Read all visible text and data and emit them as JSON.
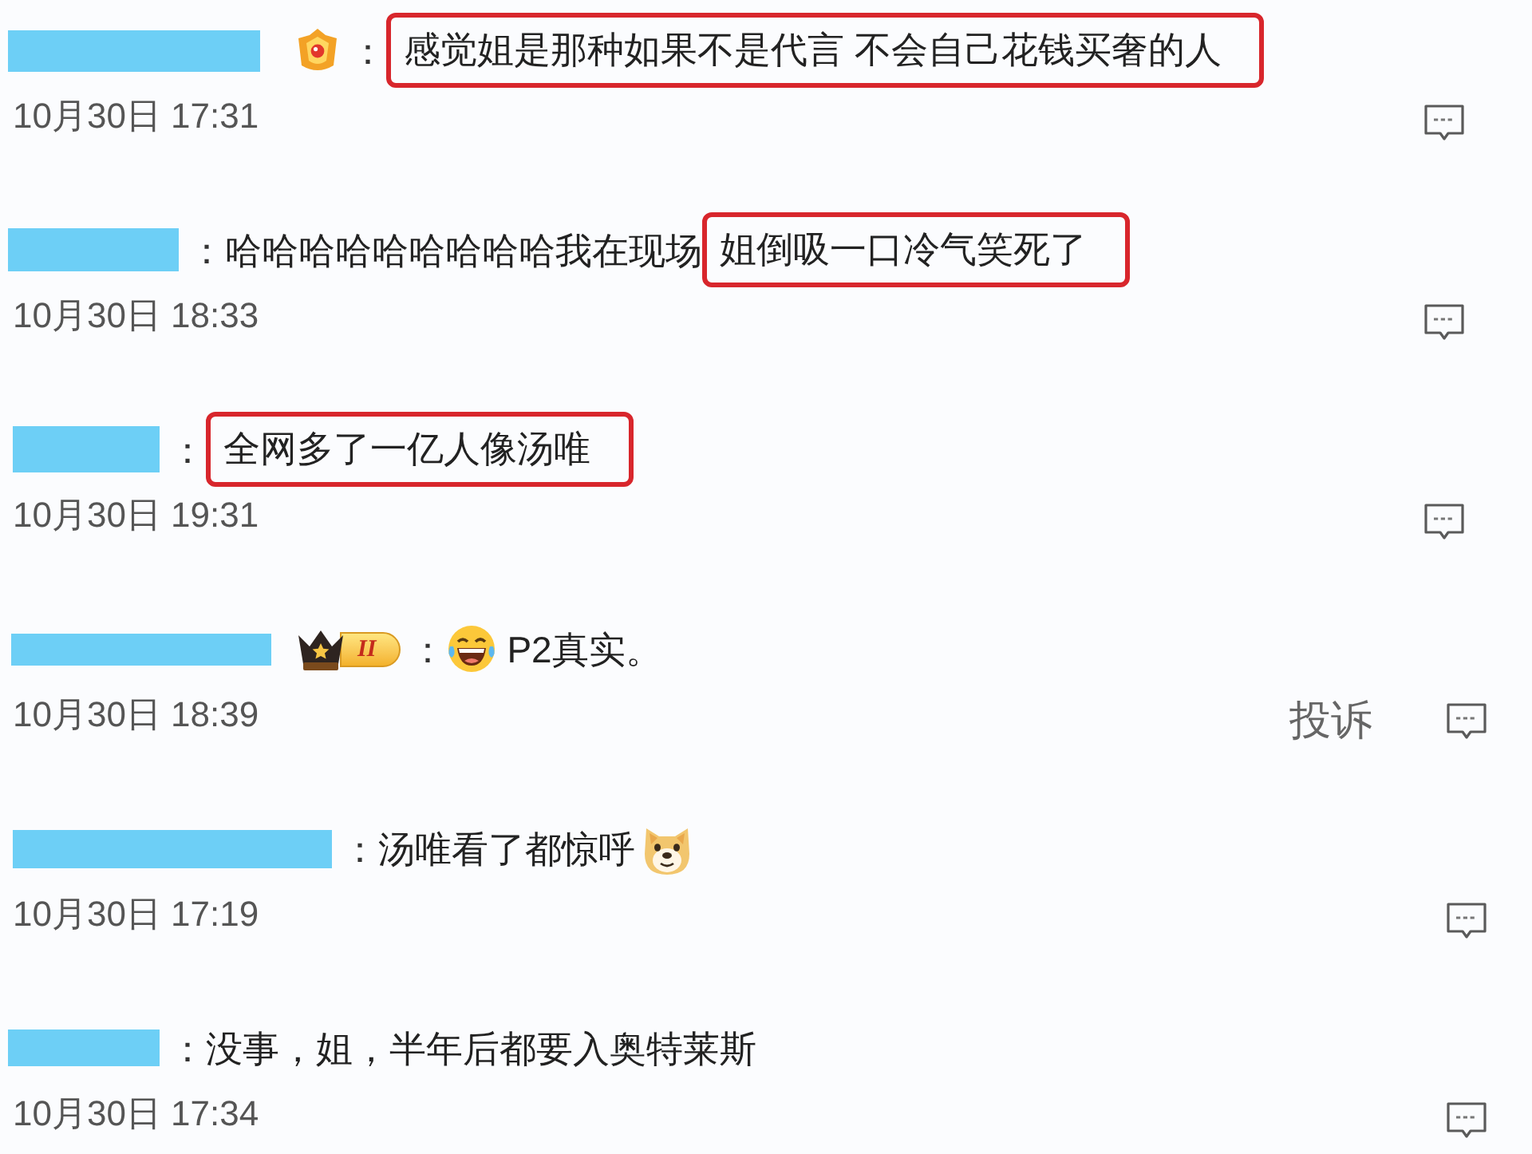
{
  "comments": [
    {
      "badge": {
        "kind": "medal"
      },
      "separator": "：",
      "segments": [
        {
          "kind": "text",
          "text": "感觉姐是那种如果不是代言 不会自己花钱买奢的人",
          "highlighted": true
        }
      ],
      "date": "10月30日 17:31"
    },
    {
      "separator": "：",
      "segments": [
        {
          "kind": "text",
          "text": "哈哈哈哈哈哈哈哈哈我在现场",
          "highlighted": false
        },
        {
          "kind": "text",
          "text": "姐倒吸一口冷气笑死了",
          "highlighted": true
        }
      ],
      "date": "10月30日 18:33"
    },
    {
      "separator": "：",
      "segments": [
        {
          "kind": "text",
          "text": "全网多了一亿人像汤唯",
          "highlighted": true
        }
      ],
      "date": "10月30日 19:31"
    },
    {
      "badge": {
        "kind": "level",
        "label": "II"
      },
      "separator": "：",
      "segments": [
        {
          "kind": "emoji"
        },
        {
          "kind": "text",
          "text": "P2真实。",
          "highlighted": false
        }
      ],
      "date": "10月30日 18:39",
      "report_link": "投诉"
    },
    {
      "separator": "：",
      "segments": [
        {
          "kind": "text",
          "text": "汤唯看了都惊呼",
          "highlighted": false
        },
        {
          "kind": "emoji"
        }
      ],
      "date": "10月30日 17:19"
    },
    {
      "separator": "：",
      "segments": [
        {
          "kind": "text",
          "text": "没事，姐，半年后都要入奥特莱斯",
          "highlighted": false
        }
      ],
      "date": "10月30日 17:34"
    }
  ]
}
